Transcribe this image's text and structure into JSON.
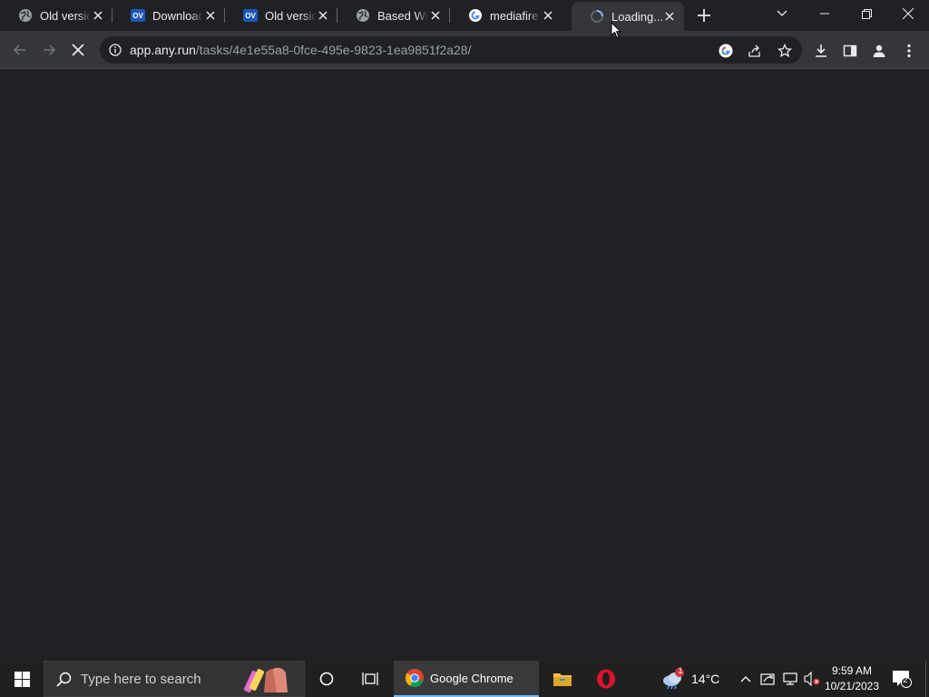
{
  "tabs": [
    {
      "title": "Old version",
      "favicon": "globe-icon"
    },
    {
      "title": "Download",
      "favicon": "ov-logo-icon"
    },
    {
      "title": "Old version",
      "favicon": "ov-logo-icon"
    },
    {
      "title": "Based Wiki",
      "favicon": "globe-icon"
    },
    {
      "title": "mediafire",
      "favicon": "google-icon"
    },
    {
      "title": "Loading...",
      "favicon": "loading-spinner-icon",
      "active": true
    }
  ],
  "address": {
    "host": "app.any.run",
    "path": "/tasks/4e1e55a8-0fce-495e-9823-1ea9851f2a28/"
  },
  "taskbar": {
    "search_placeholder": "Type here to search",
    "chrome_label": "Google Chrome",
    "weather": "14°C",
    "weather_badge": "1",
    "time": "9:59 AM",
    "date": "10/21/2023",
    "notifications": "2"
  },
  "colors": {
    "page_bg": "#202124",
    "toolbar_bg": "#35363a",
    "taskbar_bg": "#202020",
    "accent": "#76b9ed"
  }
}
